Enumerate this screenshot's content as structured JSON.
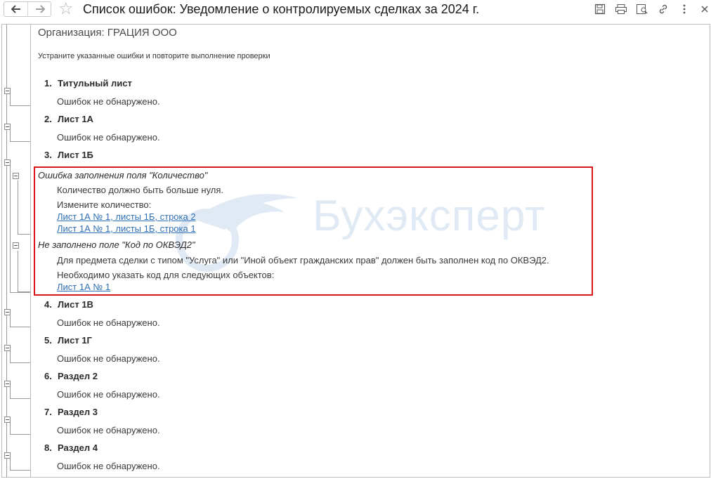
{
  "window": {
    "title": "Список ошибок: Уведомление о контролируемых сделках за 2024 г."
  },
  "toolbar_icons": [
    "back-arrow-icon",
    "forward-arrow-icon",
    "favorite-star-icon",
    "save-icon",
    "print-icon",
    "preview-icon",
    "link-icon",
    "more-icon",
    "close-icon"
  ],
  "header": {
    "organization": "Организация: ГРАЦИЯ ООО",
    "hint": "Устраните указанные ошибки и повторите выполнение проверки"
  },
  "sections": [
    {
      "num": "1.",
      "title": "Титульный лист",
      "status": "Ошибок не обнаружено."
    },
    {
      "num": "2.",
      "title": "Лист 1А",
      "status": "Ошибок не обнаружено."
    },
    {
      "num": "3.",
      "title": "Лист 1Б",
      "status": ""
    },
    {
      "num": "4.",
      "title": "Лист 1В",
      "status": "Ошибок не обнаружено."
    },
    {
      "num": "5.",
      "title": "Лист 1Г",
      "status": "Ошибок не обнаружено."
    },
    {
      "num": "6.",
      "title": "Раздел 2",
      "status": "Ошибок не обнаружено."
    },
    {
      "num": "7.",
      "title": "Раздел 3",
      "status": "Ошибок не обнаружено."
    },
    {
      "num": "8.",
      "title": "Раздел 4",
      "status": "Ошибок не обнаружено."
    }
  ],
  "errors": [
    {
      "title": "Ошибка заполнения поля \"Количество\"",
      "description": "Количество должно быть больше нуля.",
      "action": "Измените количество:",
      "links": [
        "Лист 1А № 1, листы 1Б, строка 2",
        "Лист 1А № 1, листы 1Б, строка 1"
      ]
    },
    {
      "title": "Не заполнено поле \"Код по ОКВЭД2\"",
      "description": "Для предмета сделки с типом \"Услуга\" или \"Иной объект гражданских прав\" должен быть заполнен код по ОКВЭД2.",
      "action": "Необходимо указать код для следующих объектов:",
      "links": [
        "Лист 1А № 1"
      ]
    }
  ],
  "watermark": {
    "text": "Бухэксперт"
  },
  "colors": {
    "highlight": "#d9141b",
    "link": "#2f6fb5",
    "watermark": "#3d7fc1"
  }
}
